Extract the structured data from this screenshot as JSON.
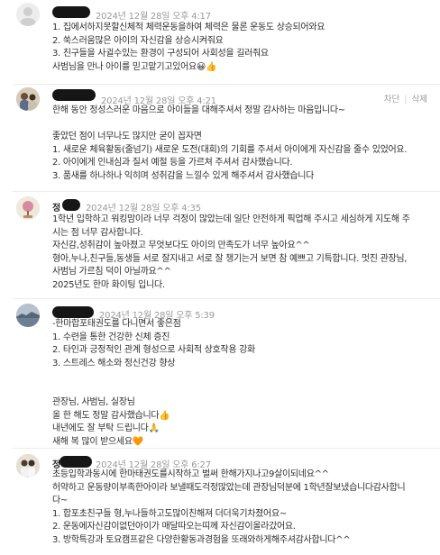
{
  "comments": [
    {
      "date": "2024년 12월 28일 오후 4:17",
      "lines": [
        "1. 집에서하지못할신체적 체력운동을하여 체력은 물론 운동도 상승되어와요",
        "2. 쑥스러움많은 아이의 자신감을 상승시켜줘요",
        "3. 친구들을 사귈수있는 환경이 구성되어 사회성을 길러줘요",
        "사범님을 만나 아이를 믿고맡기고있어요😀👍"
      ]
    },
    {
      "date": "2024년 12월 28일 오후 4:21",
      "actions": {
        "block": "차단",
        "separator": "|",
        "delete": "삭제"
      },
      "lines": [
        "한해 동안 정성스러운 마음으로 아이들을 대해주셔서 정말 감사하는 마음입니다~",
        "",
        "좋았던 점이 너무나도 많지만 굳이 꼽자면",
        "1. 새로운 체육활동(줄넘기) 새로운 도전(대회)의 기회를 주셔서 아이에게 자신감을 줄수 있었어요.",
        "2. 아이에게 인내심과 질서 예절 등을 가르쳐 주셔서 감사했습니다.",
        "3. 품새를 하나하나 익히며 성취감을 느낄수 있게 해주셔서 감사했습니다"
      ]
    },
    {
      "name_visible": "정",
      "date": "2024년 12월 28일 오후 4:35",
      "lines": [
        "1학년 입학하고 워킹맘이라 너무 걱정이 많았는데 일단 안전하게 픽업해 주시고 세심하게 지도해 주",
        "시는 점 너무 감사합니다.",
        "자신감,성취감이 높아졌고 무엇보다도 아이의 만족도가 너무 높아요^^",
        "형아,누나,친구들,동생들 서로 잘지내고 서로 잘 챙기는거 보면 참 예쁘고 기특합니다. 멋진 관장님,",
        "사범님 가르침 덕이 아닐까요^^",
        "2025년도 한마 화이팅 입니다."
      ]
    },
    {
      "date": "2024년 12월 28일 오후 5:39",
      "lines": [
        "-한마합포태권도를 다니면서 좋은점",
        "1. 수련을 통한 건강한 신체 증진",
        "2. 타인과 긍정적인 관계 형성으로 사회적 상호작용 강화",
        "3. 스트레스 해소와 정신건강 향상",
        "",
        "",
        "관장님, 사범님, 실장님",
        "올 한 해도 정말 감사했습니다👍",
        "내년에도 잘 부탁 드립니다🙏",
        "새해 복 많이 받으세요🧡"
      ]
    },
    {
      "name_visible": "정",
      "date": "2024년 12월 28일 오후 6:27",
      "lines": [
        "초등입학과동시에 한마태권도를시작하고 벌써 한해가지나고9살이되네요^^",
        "허약하고 운동량이부족한아이라 보낼때도걱정많았는데 관장님덕분에 1학년잘보냈습니다감사합니",
        "다~",
        "1. 합포초친구들 형,누나들하고도많이친해져 더더욱기차졌어요~",
        "2. 운동에자신감이없던아이가 매달따오는띠께 자신감이올라갔어요.",
        "3. 방학특강과 토요캠프같은 다양한활동과경험을 또래와하게해주셔감사합니다^^"
      ]
    }
  ]
}
